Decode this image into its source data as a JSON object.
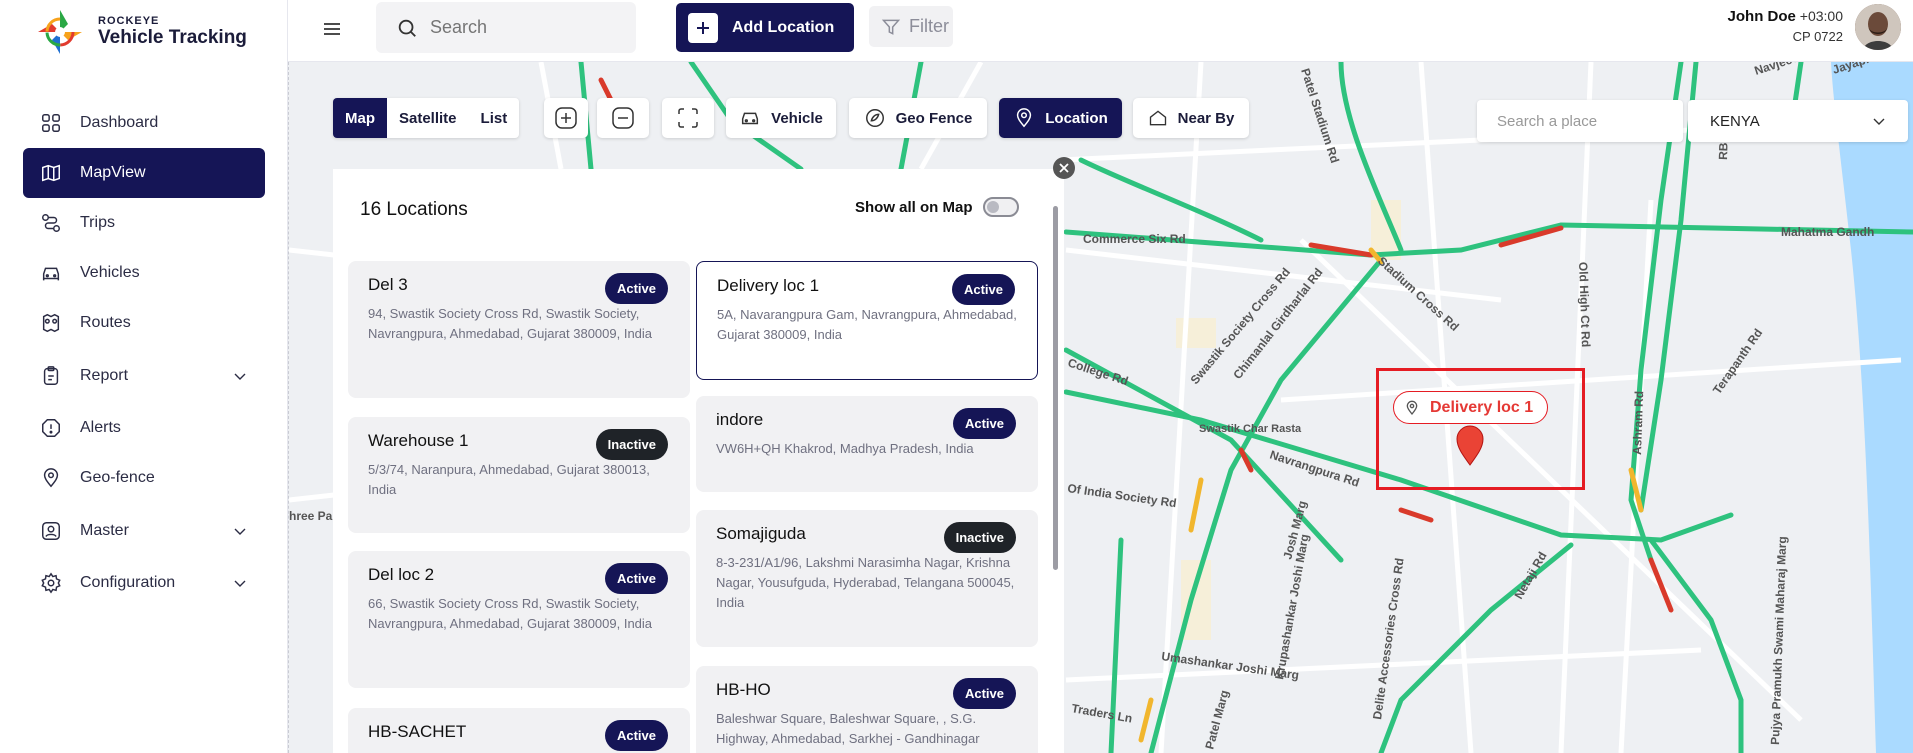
{
  "brand": {
    "small": "ROCKEYE",
    "title": "Vehicle Tracking"
  },
  "sidebar": {
    "items": [
      {
        "label": "Dashboard",
        "icon": "grid-icon"
      },
      {
        "label": "MapView",
        "icon": "map-icon",
        "active": true
      },
      {
        "label": "Trips",
        "icon": "route-icon"
      },
      {
        "label": "Vehicles",
        "icon": "car-icon"
      },
      {
        "label": "Routes",
        "icon": "routes-icon"
      },
      {
        "label": "Report",
        "icon": "clipboard-icon",
        "expandable": true
      },
      {
        "label": "Alerts",
        "icon": "alert-icon"
      },
      {
        "label": "Geo-fence",
        "icon": "pin-icon"
      },
      {
        "label": "Master",
        "icon": "user-card-icon",
        "expandable": true
      },
      {
        "label": "Configuration",
        "icon": "gear-icon",
        "expandable": true
      }
    ]
  },
  "topbar": {
    "search_placeholder": "Search",
    "add_label": "Add Location",
    "filter_label": "Filter"
  },
  "user": {
    "name": "John Doe",
    "timezone": "+03:00",
    "sub": "CP 0722"
  },
  "map_controls": {
    "views": [
      "Map",
      "Satellite",
      "List"
    ],
    "active_view": "Map",
    "layers": {
      "vehicle": "Vehicle",
      "geofence": "Geo Fence",
      "location": "Location",
      "nearby": "Near By"
    },
    "place_placeholder": "Search a place",
    "country": "KENYA"
  },
  "panel": {
    "title": "16 Locations",
    "show_all_label": "Show all on Map",
    "left": [
      {
        "name": "Del 3",
        "status": "Active",
        "address": "94, Swastik Society Cross Rd, Swastik Society, Navrangpura, Ahmedabad, Gujarat 380009, India"
      },
      {
        "name": "Warehouse 1",
        "status": "Inactive",
        "address": "5/3/74, Naranpura, Ahmedabad, Gujarat 380013, India"
      },
      {
        "name": "Del loc 2",
        "status": "Active",
        "address": "66, Swastik Society Cross Rd, Swastik Society, Navrangpura, Ahmedabad, Gujarat 380009, India"
      },
      {
        "name": "HB-SACHET",
        "status": "Active",
        "address": ""
      }
    ],
    "right": [
      {
        "name": "Delivery loc 1",
        "status": "Active",
        "address": "5A, Navarangpura Gam, Navrangpura, Ahmedabad, Gujarat 380009, India"
      },
      {
        "name": "indore",
        "status": "Active",
        "address": "VW6H+QH Khakrod, Madhya Pradesh, India"
      },
      {
        "name": "Somajiguda",
        "status": "Inactive",
        "address": "8-3-231/A1/96, Lakshmi Narasimha Nagar, Krishna Nagar, Yousufguda, Hyderabad, Telangana 500045, India"
      },
      {
        "name": "HB-HO",
        "status": "Active",
        "address": "Baleshwar Square, Baleshwar Square, , S.G. Highway, Ahmedabad, Sarkhej - Gandhinagar"
      }
    ]
  },
  "marker": {
    "label": "Delivery loc 1"
  },
  "map_labels": [
    "Commerce Six Rd",
    "Stadium Cross Rd",
    "Chimanlal Girdharlal Rd",
    "Swastik Society Cross Rd",
    "Navrangpura Rd",
    "Mahatma Gandh",
    "Old High Ct Rd",
    "Ashram Rd",
    "Terapanth Rd",
    "RBI Road",
    "Navjeevan Mar",
    "Jayapith R",
    "Patel Stadium Rd",
    "College Rd",
    "Of India Society Rd",
    "Swastik Char Rasta",
    "Josh Marg",
    "Krupashankar Joshi Marg",
    "Delite Accessories Cross Rd",
    "Netaji Rd",
    "Umashankar Joshi Marg",
    "Traders Ln",
    "Patel Marg",
    "Pujya Pramukh Swami Maharaj Marg",
    "hree Pa",
    "Ashram Rd",
    "Navrangpura Rd"
  ],
  "colors": {
    "primary": "#151556",
    "accent_red": "#e51c23",
    "inactive": "#1f2328",
    "road_green": "#2ec27e"
  }
}
